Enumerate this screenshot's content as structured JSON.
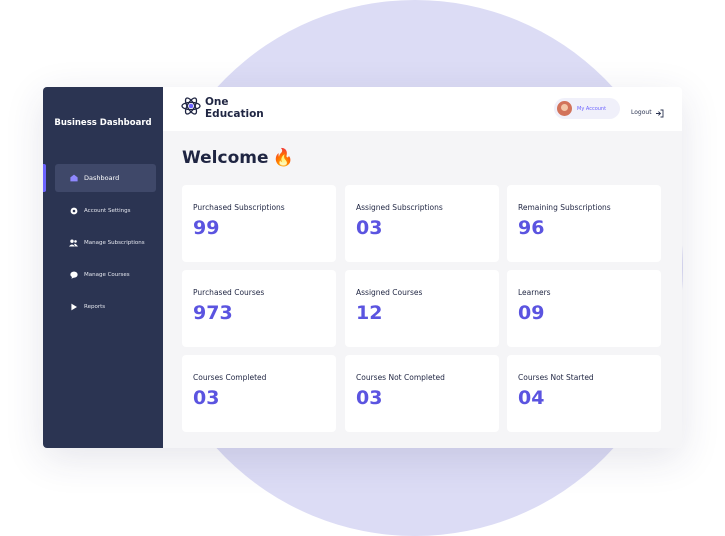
{
  "sidebar": {
    "title": "Business Dashboard",
    "items": [
      {
        "label": "Dashboard",
        "icon": "home-icon"
      },
      {
        "label": "Account Settings",
        "icon": "gear-icon"
      },
      {
        "label": "Manage Subscriptions",
        "icon": "users-icon"
      },
      {
        "label": "Manage Courses",
        "icon": "chat-icon"
      },
      {
        "label": "Reports",
        "icon": "flag-icon"
      }
    ]
  },
  "header": {
    "logo_line1": "One",
    "logo_line2": "Education",
    "account_label": "My Account",
    "logout_label": "Logout"
  },
  "main": {
    "welcome": "Welcome",
    "welcome_emoji": "🔥",
    "cards": [
      {
        "label": "Purchased Subscriptions",
        "value": "99"
      },
      {
        "label": "Assigned Subscriptions",
        "value": "03"
      },
      {
        "label": "Remaining Subscriptions",
        "value": "96"
      },
      {
        "label": "Purchased Courses",
        "value": "973"
      },
      {
        "label": "Assigned Courses",
        "value": "12"
      },
      {
        "label": "Learners",
        "value": "09"
      },
      {
        "label": "Courses Completed",
        "value": "03"
      },
      {
        "label": "Courses Not Completed",
        "value": "03"
      },
      {
        "label": "Courses Not Started",
        "value": "04"
      }
    ]
  },
  "colors": {
    "sidebar_bg": "#2b3452",
    "accent": "#5b54e0",
    "background_circle": "#dcdcf5"
  }
}
